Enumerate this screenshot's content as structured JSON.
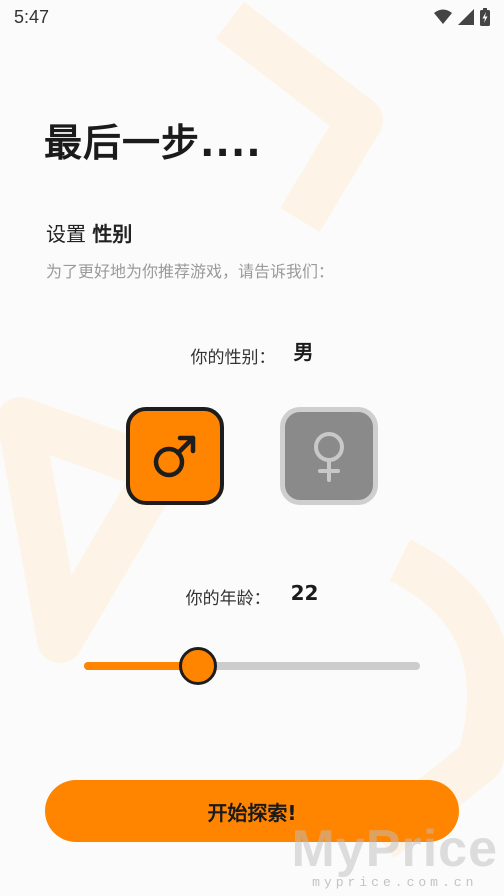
{
  "status_bar": {
    "time": "5:47",
    "icons": [
      "wifi-icon",
      "cellular-signal-icon",
      "battery-charging-icon"
    ]
  },
  "header": {
    "title": "最后一步....",
    "subtitle_prefix": "设置",
    "subtitle_emphasis": "性别",
    "description": "为了更好地为你推荐游戏，请告诉我们："
  },
  "gender": {
    "label": "你的性别：",
    "value": "男",
    "options": [
      {
        "name": "male",
        "icon": "male-symbol-icon",
        "selected": true
      },
      {
        "name": "female",
        "icon": "female-symbol-icon",
        "selected": false
      }
    ]
  },
  "age": {
    "label": "你的年龄：",
    "value": "22",
    "slider_fraction": 0.34
  },
  "actions": {
    "start_label": "开始探索!"
  },
  "watermark": {
    "main": "MyPrice",
    "sub": "myprice.com.cn"
  },
  "colors": {
    "accent": "#ff8400",
    "selected_border": "#1d1d1d",
    "unselected_bg": "#8a8a8a",
    "track": "#cccccc"
  }
}
